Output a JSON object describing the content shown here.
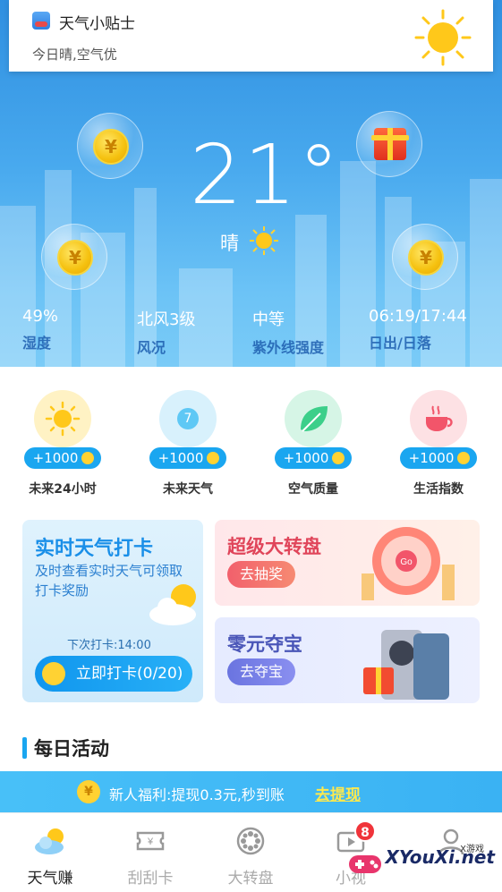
{
  "tip": {
    "title": "天气小贴士",
    "subtitle": "今日晴,空气优"
  },
  "weather": {
    "temperature": "21°",
    "condition": "晴"
  },
  "stats": [
    {
      "value": "49%",
      "label": "湿度"
    },
    {
      "value": "北风3级",
      "label": "风况"
    },
    {
      "value": "中等",
      "label": "紫外线强度"
    },
    {
      "value": "06:19/17:44",
      "label": "日出/日落"
    }
  ],
  "quick": [
    {
      "reward": "+1000",
      "label": "未来24小时",
      "icon": "sun-icon",
      "bg": "#fff2c4"
    },
    {
      "reward": "+1000",
      "label": "未来天气",
      "icon": "calendar-7-icon",
      "bg": "#d8f1fc",
      "icon_text": "7"
    },
    {
      "reward": "+1000",
      "label": "空气质量",
      "icon": "leaf-icon",
      "bg": "#d6f5e6"
    },
    {
      "reward": "+1000",
      "label": "生活指数",
      "icon": "tea-cup-icon",
      "bg": "#fde1e4"
    }
  ],
  "checkin": {
    "title": "实时天气打卡",
    "desc": "及时查看实时天气可领取打卡奖励",
    "next": "下次打卡:14:00",
    "button": "立即打卡(0/20)"
  },
  "wheel": {
    "title": "超级大转盘",
    "button": "去抽奖",
    "wheel_text": "Go"
  },
  "treasure": {
    "title": "零元夺宝",
    "button": "去夺宝"
  },
  "section": {
    "title": "每日活动"
  },
  "banner": {
    "coin": "¥",
    "text": "新人福利:提现0.3元,秒到账",
    "link": "去提现"
  },
  "tabs": [
    {
      "label": "天气赚",
      "icon": "cloud-sun-icon",
      "active": true
    },
    {
      "label": "刮刮卡",
      "icon": "ticket-icon"
    },
    {
      "label": "大转盘",
      "icon": "wheel-icon"
    },
    {
      "label": "小视",
      "icon": "video-icon",
      "badge": "8"
    },
    {
      "label": "",
      "icon": "user-icon"
    }
  ],
  "watermark": {
    "main": "XYouXi.net",
    "sub": "X游戏"
  },
  "colors": {
    "accent": "#1aa6f0",
    "coin": "#ffd233"
  }
}
